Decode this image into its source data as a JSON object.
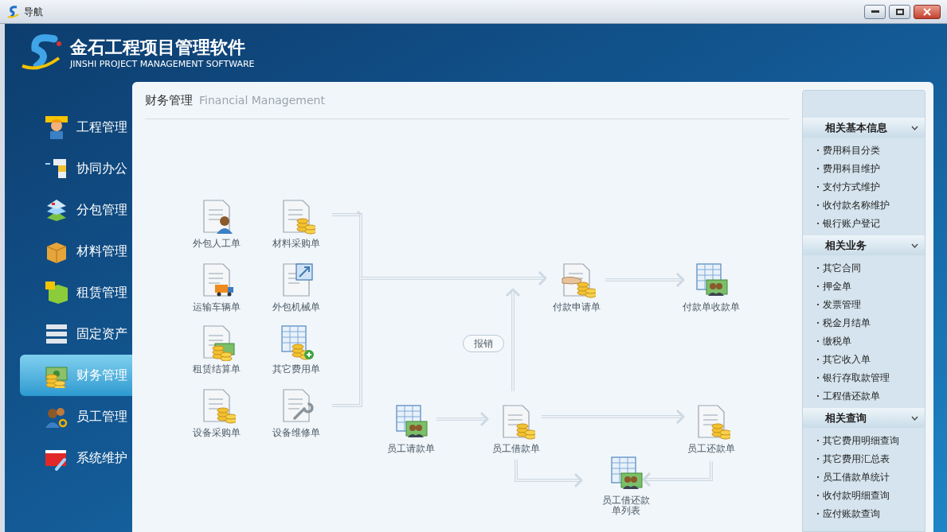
{
  "window": {
    "title": "导航"
  },
  "header": {
    "title": "金石工程项目管理软件",
    "subtitle": "JINSHI PROJECT MANAGEMENT SOFTWARE"
  },
  "sidebar": {
    "items": [
      {
        "label": "工程管理",
        "selected": false
      },
      {
        "label": "协同办公",
        "selected": false
      },
      {
        "label": "分包管理",
        "selected": false
      },
      {
        "label": "材料管理",
        "selected": false
      },
      {
        "label": "租赁管理",
        "selected": false
      },
      {
        "label": "固定资产",
        "selected": false
      },
      {
        "label": "财务管理",
        "selected": true
      },
      {
        "label": "员工管理",
        "selected": false
      },
      {
        "label": "系统维护",
        "selected": false
      }
    ]
  },
  "page": {
    "title": "财务管理",
    "subtitle": "Financial Management"
  },
  "flow": {
    "nodes": [
      {
        "label": "外包人工单"
      },
      {
        "label": "材料采购单"
      },
      {
        "label": "运输车辆单"
      },
      {
        "label": "外包机械单"
      },
      {
        "label": "租赁结算单"
      },
      {
        "label": "其它费用单"
      },
      {
        "label": "设备采购单"
      },
      {
        "label": "设备维修单"
      },
      {
        "label": "付款申请单"
      },
      {
        "label": "付款单收款单"
      },
      {
        "label": "员工请款单"
      },
      {
        "label": "员工借款单"
      },
      {
        "label": "员工还款单"
      },
      {
        "label": "员工借还款单列表"
      }
    ],
    "tag": "报销"
  },
  "related": {
    "sections": [
      {
        "title": "相关基本信息",
        "expanded": true,
        "items": [
          "费用科目分类",
          "费用科目维护",
          "支付方式维护",
          "收付款名称维护",
          "银行账户登记"
        ]
      },
      {
        "title": "相关业务",
        "expanded": true,
        "items": [
          "其它合同",
          "押金单",
          "发票管理",
          "税金月结单",
          "缴税单",
          "其它收入单",
          "银行存取款管理",
          "工程借还款单"
        ]
      },
      {
        "title": "相关查询",
        "expanded": true,
        "items": [
          "其它费用明细查询",
          "其它费用汇总表",
          "员工借款单统计",
          "收付款明细查询",
          "应付账款查询"
        ]
      }
    ]
  }
}
